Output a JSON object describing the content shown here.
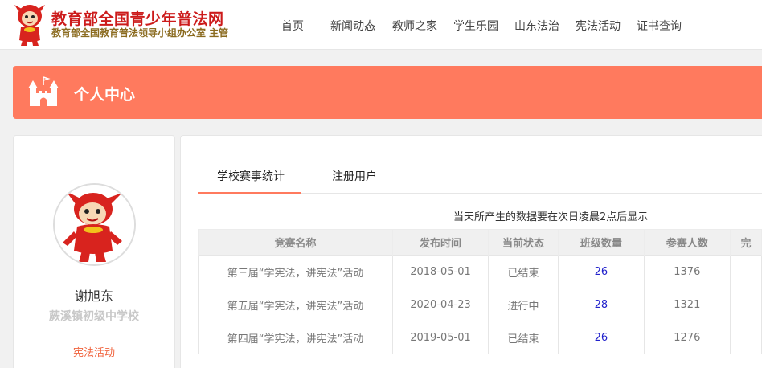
{
  "header": {
    "site_title": "教育部全国青少年普法网",
    "site_subtitle": "教育部全国教育普法领导小组办公室 主管",
    "nav": [
      "首页",
      "新闻动态",
      "教师之家",
      "学生乐园",
      "山东法治",
      "宪法活动",
      "证书查询"
    ]
  },
  "banner": {
    "title": "个人中心"
  },
  "profile": {
    "name": "谢旭东",
    "school": "蕨溪镇初级中学校",
    "link": "宪法活动"
  },
  "tabs": [
    {
      "label": "学校赛事统计",
      "active": true
    },
    {
      "label": "注册用户",
      "active": false
    }
  ],
  "notice": "当天所产生的数据要在次日凌晨2点后显示",
  "table": {
    "headers": [
      "竞赛名称",
      "发布时间",
      "当前状态",
      "班级数量",
      "参赛人数",
      "完"
    ],
    "rows": [
      [
        "第三届“学宪法，讲宪法”活动",
        "2018-05-01",
        "已结束",
        "26",
        "1376"
      ],
      [
        "第五届“学宪法，讲宪法”活动",
        "2020-04-23",
        "进行中",
        "28",
        "1321"
      ],
      [
        "第四届“学宪法，讲宪法”活动",
        "2019-05-01",
        "已结束",
        "26",
        "1276"
      ]
    ]
  },
  "colors": {
    "accent": "#ff7a5e",
    "brand_red": "#cc1b1b",
    "link_blue": "#2222cc"
  }
}
